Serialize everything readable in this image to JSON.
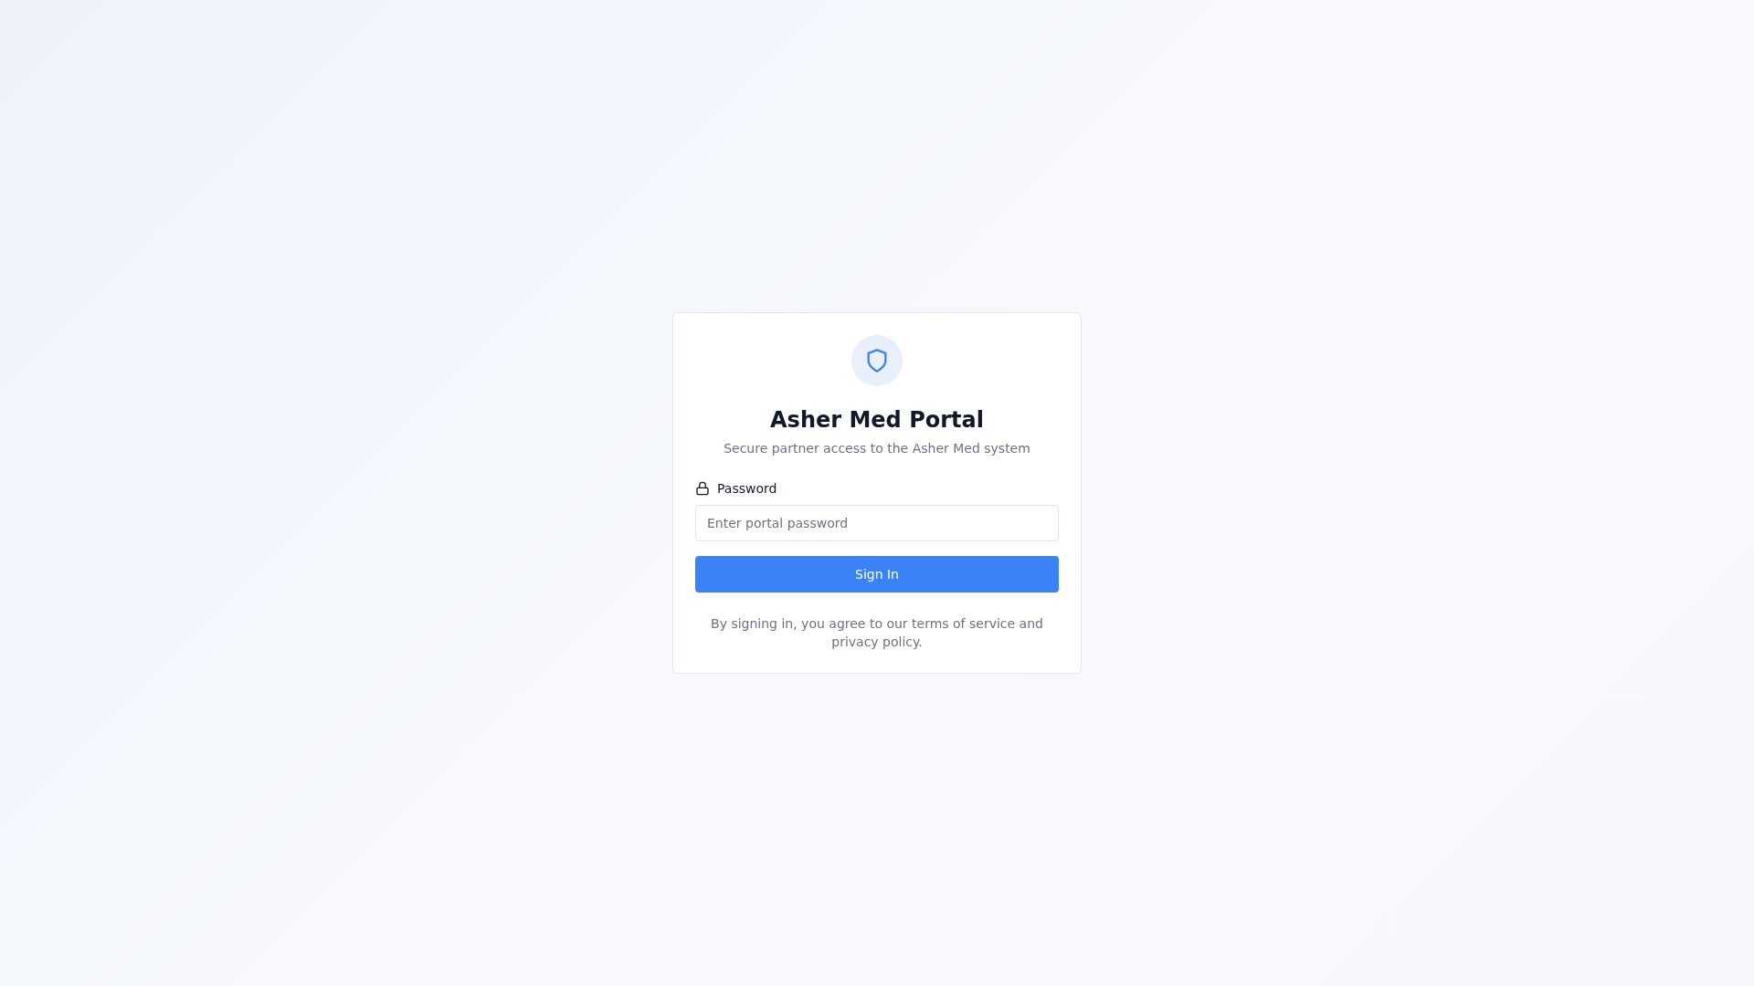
{
  "card": {
    "title": "Asher Med Portal",
    "subtitle": "Secure partner access to the Asher Med system"
  },
  "password_field": {
    "label": "Password",
    "placeholder": "Enter portal password"
  },
  "sign_in_button": {
    "label": "Sign In"
  },
  "footer_note": "By signing in, you agree to our terms of service and privacy policy."
}
